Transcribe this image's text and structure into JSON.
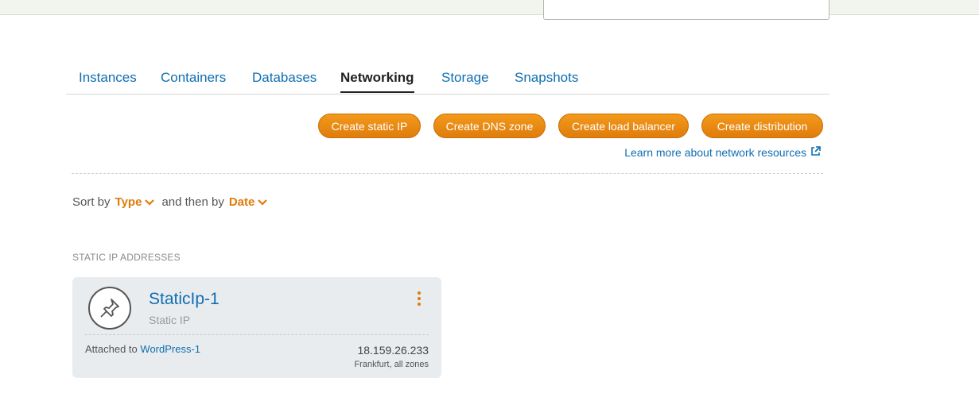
{
  "tabs": [
    {
      "label": "Instances"
    },
    {
      "label": "Containers"
    },
    {
      "label": "Databases"
    },
    {
      "label": "Networking",
      "active": true
    },
    {
      "label": "Storage"
    },
    {
      "label": "Snapshots"
    }
  ],
  "actions": {
    "create_static_ip": "Create static IP",
    "create_dns_zone": "Create DNS zone",
    "create_load_balancer": "Create load balancer",
    "create_distribution": "Create distribution",
    "learn_more": "Learn more about network resources"
  },
  "sort": {
    "prefix": "Sort by",
    "primary": "Type",
    "middle": "and then by",
    "secondary": "Date"
  },
  "section": {
    "label": "STATIC IP ADDRESSES"
  },
  "static_ip_card": {
    "name": "StaticIp-1",
    "type": "Static IP",
    "attached_prefix": "Attached to",
    "attached_instance": "WordPress-1",
    "ip_address": "18.159.26.233",
    "region": "Frankfurt, all zones",
    "icon": "pushpin-icon"
  },
  "colors": {
    "accent_orange": "#e07b0c",
    "link_blue": "#0e6eb2",
    "card_bg": "#e9ecee"
  }
}
